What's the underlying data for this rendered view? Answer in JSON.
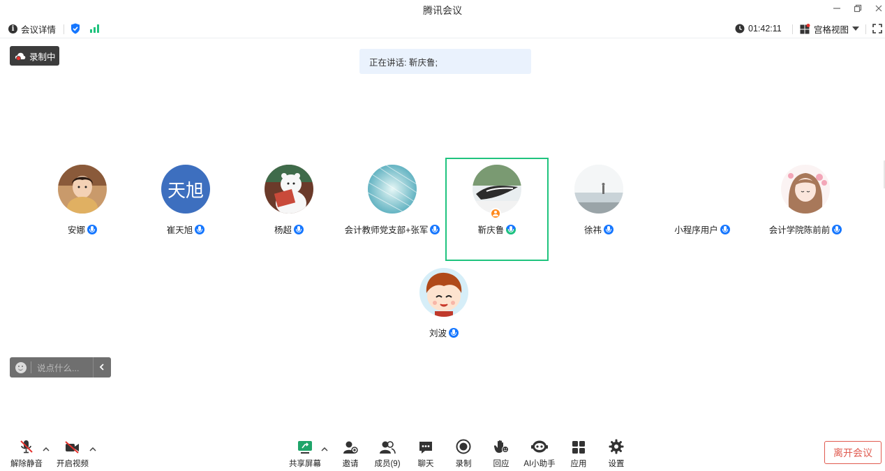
{
  "window": {
    "title": "腾讯会议"
  },
  "infobar": {
    "meeting_details": "会议详情",
    "timer": "01:42:11",
    "view_mode": "宫格视图"
  },
  "recording": {
    "label": "录制中"
  },
  "speaking_banner": {
    "text": "正在讲话: 靳庆鲁;"
  },
  "participants": [
    {
      "name": "安娜"
    },
    {
      "name": "崔天旭",
      "avatar_text": "天旭"
    },
    {
      "name": "杨超"
    },
    {
      "name": "会计教师党支部+张军"
    },
    {
      "name": "靳庆鲁"
    },
    {
      "name": "徐祎"
    },
    {
      "name": "小程序用户"
    },
    {
      "name": "会计学院陈前前"
    },
    {
      "name": "刘波"
    }
  ],
  "chat": {
    "placeholder": "说点什么..."
  },
  "toolbar": {
    "unmute": "解除静音",
    "start_video": "开启视频",
    "share_screen": "共享屏幕",
    "invite": "邀请",
    "members": "成员(9)",
    "chat": "聊天",
    "record": "录制",
    "react": "回应",
    "ai_assistant": "AI小助手",
    "apps": "应用",
    "settings": "设置",
    "leave": "离开会议"
  },
  "colors": {
    "active_border": "#1fc37e",
    "mic_blue": "#1677ff",
    "leave_red": "#e05a4f",
    "banner_bg": "#eaf2fd"
  }
}
